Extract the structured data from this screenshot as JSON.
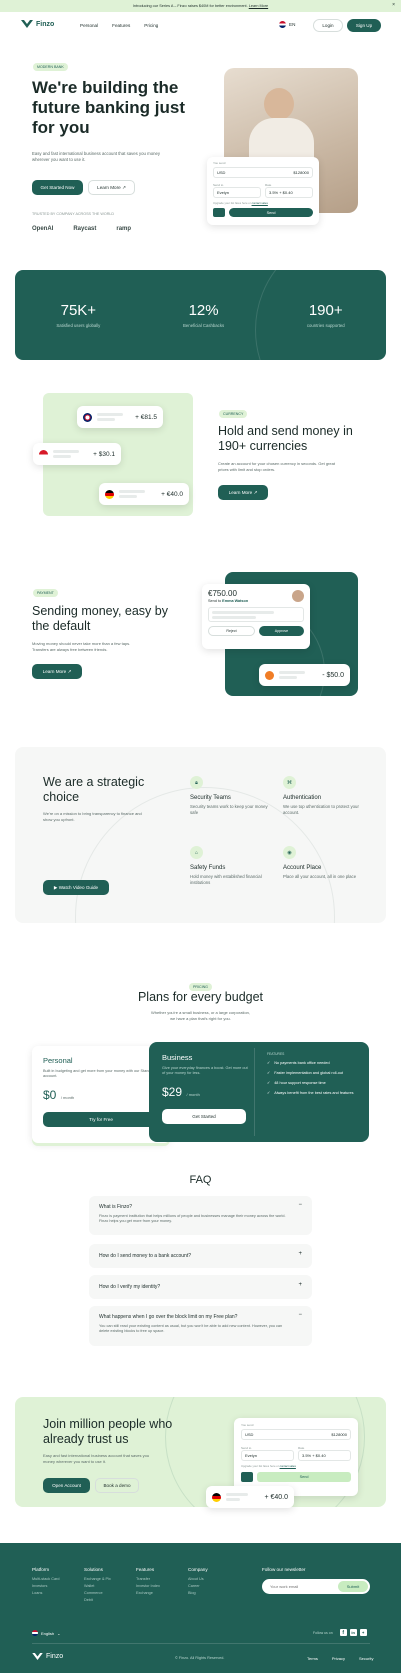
{
  "banner": {
    "text": "Introducing our Series A – Finzo raises $40M for better environment.",
    "link": "Learn More"
  },
  "nav": {
    "logo": "Finzo",
    "links": [
      "Personal",
      "Features",
      "Pricing"
    ],
    "lang": "EN",
    "login": "Login",
    "signup": "Sign Up"
  },
  "hero": {
    "tag": "MODERN BANK",
    "title": "We're building the future banking just for you",
    "desc": "Easy and fast international business account that saves you money wherever you want to use it.",
    "primary": "Get Started Now",
    "secondary": "Learn More",
    "trusted": "TRUSTED BY COMPANY ACROSS THE WORLD",
    "logos": [
      "OpenAI",
      "Raycast",
      "ramp"
    ],
    "widget": {
      "send_label": "You send",
      "currency": "USD",
      "amount": "$128000",
      "recipient_label": "Send to",
      "recipient": "Evelyn",
      "rate_label": "Rate",
      "rate": "3.5% + $0.40",
      "note": "Upgrade your list fares here or",
      "note_link": "contact sales",
      "send_btn": "Send"
    }
  },
  "stats": [
    {
      "value": "75K+",
      "label": "Satisfied users globally"
    },
    {
      "value": "12%",
      "label": "Beneficial Cashbacks"
    },
    {
      "value": "190+",
      "label": "countries supported"
    }
  ],
  "currency": {
    "tag": "CURRENCY",
    "title": "Hold and send money in 190+ currencies",
    "desc": "Create an account for your chosen currency in seconds. Get great prices with limit and stop orders.",
    "btn": "Learn More",
    "amounts": [
      "+ €81.5",
      "+ $30.1",
      "+ €40.0"
    ]
  },
  "payment": {
    "tag": "PAYMENT",
    "title": "Sending money, easy by the default",
    "desc": "Moving money should never take more than a few taps. Transfers are always free between friends.",
    "btn": "Learn More",
    "card_amount": "€750.00",
    "card_to": "Send to",
    "card_name": "Emma Watson",
    "reject": "Reject",
    "approve": "Approve",
    "out_amount": "- $50.0"
  },
  "strategic": {
    "title": "We are a strategic choice",
    "desc": "We're on a mission to bring transparency to finance and show you upfront.",
    "btn": "Watch Video Guide",
    "features": [
      {
        "title": "Security Teams",
        "desc": "Security teams work to keep your money safe"
      },
      {
        "title": "Authentication",
        "desc": "We use top uthentication to protect your account."
      },
      {
        "title": "Safety Funds",
        "desc": "Hold money with established financial institutions"
      },
      {
        "title": "Account Place",
        "desc": "Place all your account, all in one place"
      }
    ]
  },
  "pricing": {
    "tag": "PRICING",
    "title": "Plans for every budget",
    "desc": "Whether you're a small business, or a large corporation, we have a plan that's right for you.",
    "personal": {
      "name": "Personal",
      "desc": "Built in budgeting and get more from your money with our Standard account.",
      "price": "$0",
      "per": "/ month",
      "btn": "Try for Free"
    },
    "business": {
      "name": "Business",
      "desc": "Give your everyday finances a boost. Get more out of your money for less.",
      "price": "$29",
      "per": "/ month",
      "btn": "Get Started",
      "features_label": "FEATURES",
      "features": [
        "No payments bank office needed",
        "Faster implementation and global roll-out",
        "48 hour support response time",
        "Always benefit from the best rates and features"
      ]
    }
  },
  "faq": {
    "title": "FAQ",
    "items": [
      {
        "q": "What is Finzo?",
        "a": "Finzo is payment institution that helps millions of people and businesses manage their money across the world. Finzo helps you get more from your money.",
        "open": true
      },
      {
        "q": "How do I send money to a bank account?",
        "a": "",
        "open": false
      },
      {
        "q": "How do I verify my identity?",
        "a": "",
        "open": false
      },
      {
        "q": "What happens when I go over the block limit on my Free plan?",
        "a": "You can still read your existing content as usual, but you won't be able to add new content. However, you can delete existing blocks to free up space.",
        "open": true
      }
    ]
  },
  "cta": {
    "title": "Join million people who already trust us",
    "desc": "Easy and fast international business account that saves you money wherever you want to use it.",
    "primary": "Open Account",
    "secondary": "Book a demo",
    "amount": "+ €40.0"
  },
  "footer": {
    "cols": [
      {
        "title": "Platform",
        "links": [
          "Multi-stack Card",
          "Investors",
          "Loans"
        ]
      },
      {
        "title": "Solutions",
        "links": [
          "Exchange & Pix",
          "Wallet",
          "Commerce",
          "Debit"
        ]
      },
      {
        "title": "Features",
        "links": [
          "Transfer",
          "Investor Index",
          "Exchange"
        ]
      },
      {
        "title": "Company",
        "links": [
          "About Us",
          "Career",
          "Blog"
        ]
      }
    ],
    "newsletter": "Follow our newsletter",
    "email_placeholder": "Your work email",
    "submit": "Submit",
    "lang": "English",
    "follow": "Follow us on",
    "logo": "Finzo",
    "copyright": "© Finzo. All Rights Reserved.",
    "legal": [
      "Terms",
      "Privacy",
      "Security"
    ]
  },
  "colors": {
    "brand": "#205f55",
    "accent": "#dff2d6"
  }
}
